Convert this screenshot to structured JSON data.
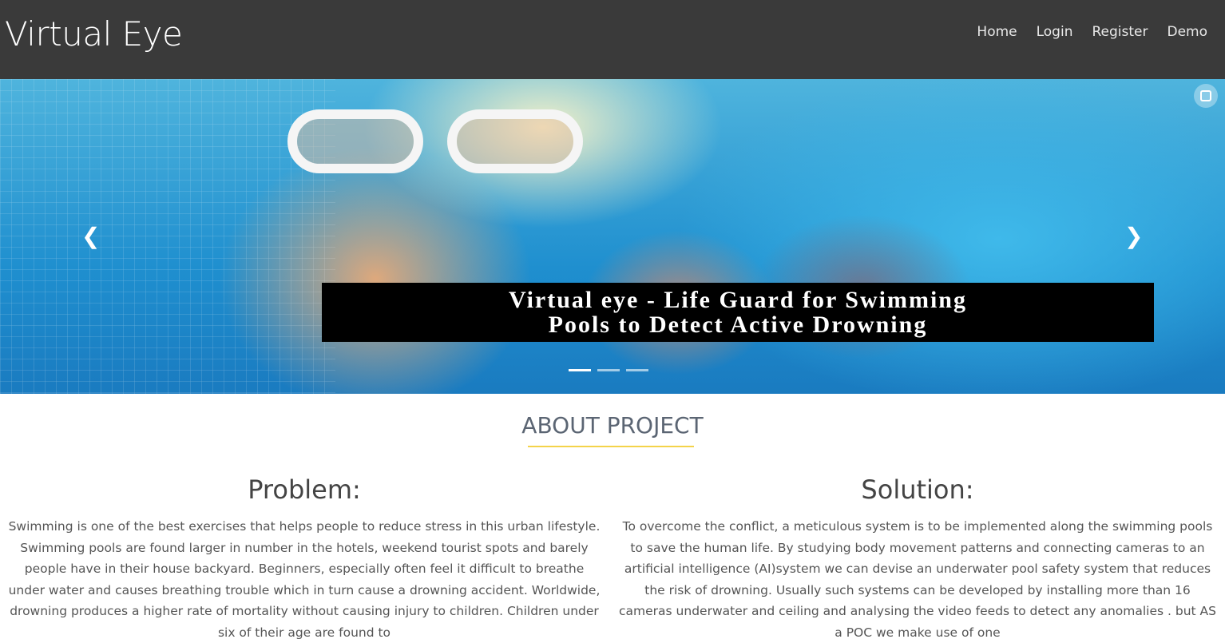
{
  "navbar": {
    "brand": "Virtual Eye",
    "links": [
      "Home",
      "Login",
      "Register",
      "Demo"
    ]
  },
  "carousel": {
    "caption_line1": "Virtual eye - Life Guard for Swimming",
    "caption_line2": "Pools to Detect Active Drowning",
    "prev_icon": "chevron-left-icon",
    "next_icon": "chevron-right-icon",
    "slide_count": 3,
    "active_slide": 1
  },
  "about": {
    "title": "ABOUT PROJECT",
    "accent_color": "#f4d34a",
    "problem": {
      "heading": "Problem:",
      "text": "Swimming is one of the best exercises that helps people to reduce stress in this urban lifestyle. Swimming pools are found larger in number in the hotels, weekend tourist spots and barely people have in their house backyard. Beginners, especially often feel it difficult to breathe under water and causes breathing trouble which in turn cause a drowning accident. Worldwide, drowning produces a higher rate of mortality without causing injury to children. Children under six of their age are found to"
    },
    "solution": {
      "heading": "Solution:",
      "text": "To overcome the conflict, a meticulous system is to be implemented along the swimming pools to save the human life. By studying body movement patterns and connecting cameras to an artificial intelligence (AI)system we can devise an underwater pool safety system that reduces the risk of drowning. Usually such systems can be developed by installing more than 16 cameras underwater and ceiling and analysing the video feeds to detect any anomalies . but AS a POC we make use of one"
    }
  }
}
